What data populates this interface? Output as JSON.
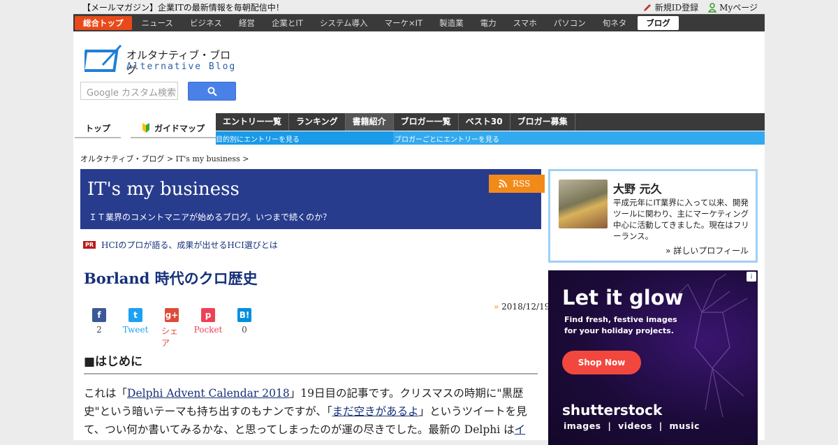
{
  "topbar": {
    "notice": "【メールマガジン】企業ITの最新情報を毎朝配信中！",
    "register": "新規ID登録",
    "mypage": "Myページ"
  },
  "nav": {
    "items": [
      "総合トップ",
      "ニュース",
      "ビジネス",
      "経営",
      "企業とIT",
      "システム導入",
      "マーケ×IT",
      "製造業",
      "電力",
      "スマホ",
      "パソコン",
      "旬ネタ",
      "ブログ"
    ]
  },
  "logo": {
    "jp": "オルタナティブ・ブログ",
    "en": "Alternative Blog"
  },
  "search": {
    "placeholder": "Google カスタム検索"
  },
  "subtabs": {
    "top": "トップ",
    "guide": "ガイドマップ"
  },
  "bar2": {
    "items": [
      "エントリー一覧",
      "ランキング",
      "書籍紹介",
      "ブロガー一覧",
      "ベスト30",
      "ブロガー募集"
    ]
  },
  "bar3": {
    "left": "目的別にエントリーを見る",
    "right": "ブロガーごとにエントリーを見る"
  },
  "breadcrumb": "オルタナティブ・ブログ > IT's my business >",
  "blog": {
    "title": "IT's my business",
    "subtitle": "ＩＴ業界のコメントマニアが始めるブログ。いつまで続くのか？",
    "rss": "RSS"
  },
  "pr": {
    "badge": "PR",
    "text": "HCIのプロが語る、成果が出せるHCI選びとは"
  },
  "entry": {
    "title": "Borland 時代のクロ歴史",
    "date_mark": "»",
    "date": "2018/12/19",
    "share": [
      {
        "icon": "f",
        "count": "2",
        "color": "#3b5998"
      },
      {
        "icon": "t",
        "count": "Tweet",
        "color": "#1da1f2"
      },
      {
        "icon": "g+",
        "count": "シェア",
        "color": "#dd4b39"
      },
      {
        "icon": "p",
        "count": "Pocket",
        "color": "#ef4056"
      },
      {
        "icon": "B!",
        "count": "0",
        "color": "#008fde"
      }
    ],
    "heading": "■はじめに",
    "p1a": "これは「",
    "link1": "Delphi Advent Calendar 2018",
    "p1b": "」19日目の記事です。クリスマスの時期に\"黒歴史\"という暗いテーマも持ち出すのもナンですが、「",
    "link2": "まだ空きがあるよ",
    "p1c": "」というツイートを見て、つい何か書いてみるかな、と思ってしまったのが運の尽きでした。最新の Delphi は",
    "link3": "イ"
  },
  "profile": {
    "name": "大野 元久",
    "desc": "平成元年にIT業界に入って以来、開発ツールに関わり、主にマーケティング中心に活動してきました。現在はフリーランス。",
    "more": "» 詳しいプロフィール"
  },
  "ad": {
    "headline": "Let it glow",
    "line1": "Find fresh, festive images",
    "line2": "for your holiday projects.",
    "cta": "Shop Now",
    "brand": "shutterstock",
    "cats": "images  |  videos  |  music",
    "info": "i"
  }
}
